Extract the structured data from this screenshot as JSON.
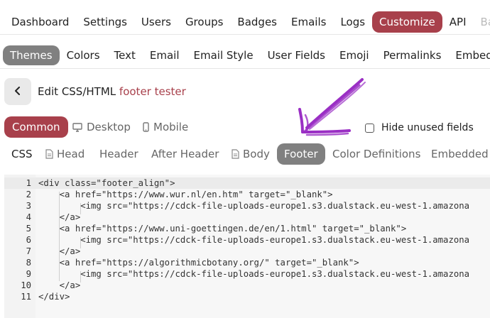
{
  "top_nav": {
    "items": [
      "Dashboard",
      "Settings",
      "Users",
      "Groups",
      "Badges",
      "Emails",
      "Logs",
      "Customize",
      "API",
      "Ba"
    ],
    "active": "Customize"
  },
  "sub_nav": {
    "items": [
      "Themes",
      "Colors",
      "Text",
      "Email",
      "Email Style",
      "User Fields",
      "Emoji",
      "Permalinks",
      "Embedd"
    ],
    "active": "Themes"
  },
  "edit_header": {
    "prefix": "Edit CSS/HTML",
    "theme_name": "footer tester"
  },
  "view_tabs": {
    "common": "Common",
    "desktop": "Desktop",
    "mobile": "Mobile"
  },
  "hide_unused": {
    "label": "Hide unused fields",
    "checked": false
  },
  "file_tabs": {
    "css": "CSS",
    "head": "Head",
    "header": "Header",
    "after_header": "After Header",
    "body": "Body",
    "footer": "Footer",
    "color_definitions": "Color Definitions",
    "embedded": "Embedded"
  },
  "colors": {
    "accent": "#a8404b",
    "active_tab": "#808080",
    "annotation_arrow": "#9a2fc4"
  },
  "editor": {
    "active_line": 1,
    "lines": [
      {
        "n": "1",
        "text": "<div class=\"footer_align\">"
      },
      {
        "n": "2",
        "text": "    <a href=\"https://www.wur.nl/en.htm\" target=\"_blank\">"
      },
      {
        "n": "3",
        "text": "        <img src=\"https://cdck-file-uploads-europe1.s3.dualstack.eu-west-1.amazona"
      },
      {
        "n": "4",
        "text": "    </a>"
      },
      {
        "n": "5",
        "text": "    <a href=\"https://www.uni-goettingen.de/en/1.html\" target=\"_blank\">"
      },
      {
        "n": "6",
        "text": "        <img src=\"https://cdck-file-uploads-europe1.s3.dualstack.eu-west-1.amazona"
      },
      {
        "n": "7",
        "text": "    </a>"
      },
      {
        "n": "8",
        "text": "    <a href=\"https://algorithmicbotany.org/\" target=\"_blank\">"
      },
      {
        "n": "9",
        "text": "        <img src=\"https://cdck-file-uploads-europe1.s3.dualstack.eu-west-1.amazona"
      },
      {
        "n": "10",
        "text": "    </a>"
      },
      {
        "n": "11",
        "text": "</div>"
      }
    ]
  }
}
